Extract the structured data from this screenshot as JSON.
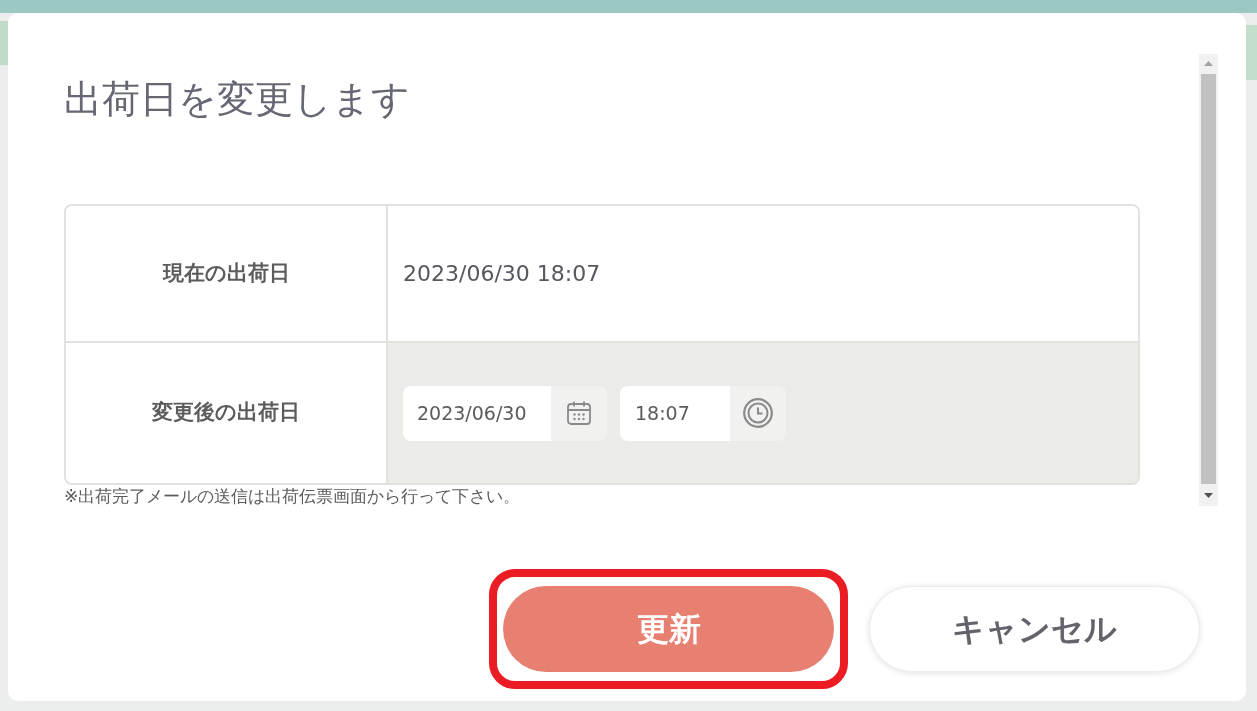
{
  "dialog": {
    "title": "出荷日を変更します",
    "table": {
      "rows": [
        {
          "kind": "text",
          "label": "現在の出荷日",
          "value": "2023/06/30 18:07"
        },
        {
          "kind": "inputs",
          "label": "変更後の出荷日",
          "date": "2023/06/30",
          "time": "18:07"
        }
      ]
    },
    "note": "※出荷完了メールの送信は出荷伝票画面から行って下さい。",
    "buttons": [
      {
        "kind": "primary",
        "label": "更新",
        "highlighted": true
      },
      {
        "kind": "secondary",
        "label": "キャンセル",
        "highlighted": false
      }
    ]
  }
}
